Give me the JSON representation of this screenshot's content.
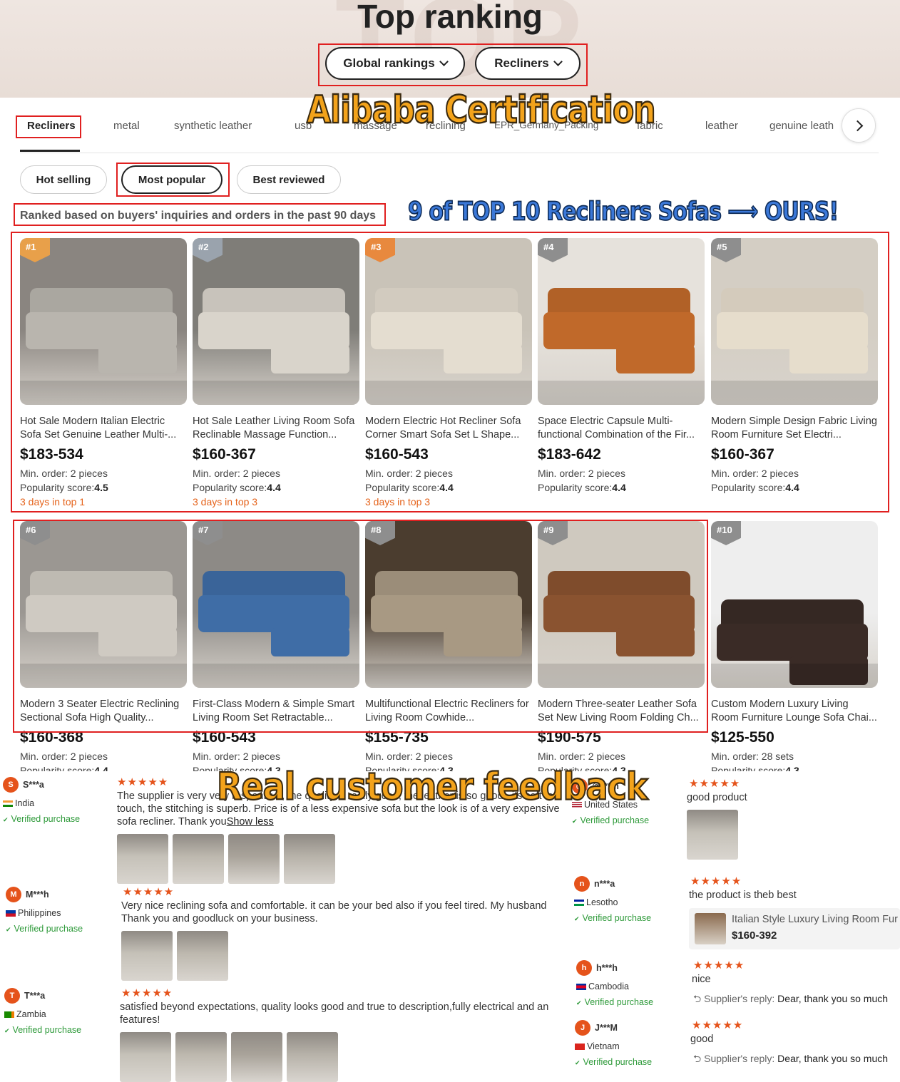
{
  "hero": {
    "title": "Top ranking",
    "dropdown_global": "Global rankings",
    "dropdown_category": "Recliners"
  },
  "overlays": {
    "certification": "Alibaba Certification",
    "top10": "9 of TOP 10 Recliners Sofas ⟶ OURS!",
    "feedback": "Real customer feedback"
  },
  "categories": [
    "Recliners",
    "metal",
    "synthetic leather",
    "usb",
    "massage",
    "reclining",
    "EPR_Germany_Packing",
    "fabric",
    "leather",
    "genuine leath"
  ],
  "filters": [
    "Hot selling",
    "Most popular",
    "Best reviewed"
  ],
  "ranked_note": "Ranked based on buyers' inquiries and orders in the past 90 days",
  "products": [
    {
      "rank": "#1",
      "title": "Hot Sale Modern Italian Electric Sofa Set Genuine Leather Multi-...",
      "price": "$183-534",
      "moq": "Min. order: 2 pieces",
      "pop_label": "Popularity score:",
      "pop_value": "4.5",
      "days": "3 days in top 1",
      "badge_color": "#e8a04a",
      "sofa_color": "#b9b5ae",
      "bg": "#8a8580"
    },
    {
      "rank": "#2",
      "title": "Hot Sale Leather Living Room Sofa Reclinable Massage Function...",
      "price": "$160-367",
      "moq": "Min. order: 2 pieces",
      "pop_label": "Popularity score:",
      "pop_value": "4.4",
      "days": "3 days in top 3",
      "badge_color": "#9aa3ad",
      "sofa_color": "#d9d4cb",
      "bg": "#7f7d78"
    },
    {
      "rank": "#3",
      "title": "Modern Electric Hot Recliner Sofa Corner Smart Sofa Set L Shape...",
      "price": "$160-543",
      "moq": "Min. order: 2 pieces",
      "pop_label": "Popularity score:",
      "pop_value": "4.4",
      "days": "3 days in top 3",
      "badge_color": "#e8893e",
      "sofa_color": "#e4ddd0",
      "bg": "#c9c3b8"
    },
    {
      "rank": "#4",
      "title": "Space Electric Capsule Multi-functional Combination of the Fir...",
      "price": "$183-642",
      "moq": "Min. order: 2 pieces",
      "pop_label": "Popularity score:",
      "pop_value": "4.4",
      "days": "",
      "badge_color": "#8e8e8e",
      "sofa_color": "#c0692a",
      "bg": "#e6e2dc"
    },
    {
      "rank": "#5",
      "title": "Modern Simple Design Fabric Living Room Furniture Set Electri...",
      "price": "$160-367",
      "moq": "Min. order: 2 pieces",
      "pop_label": "Popularity score:",
      "pop_value": "4.4",
      "days": "",
      "badge_color": "#8e8e8e",
      "sofa_color": "#e6ddcc",
      "bg": "#d4cec4"
    },
    {
      "rank": "#6",
      "title": "Modern 3 Seater Electric Reclining Sectional Sofa High Quality...",
      "price": "$160-368",
      "moq": "Min. order: 2 pieces",
      "pop_label": "Popularity score:",
      "pop_value": "4.4",
      "days": "",
      "badge_color": "#8e8e8e",
      "sofa_color": "#cfcac2",
      "bg": "#9b9792"
    },
    {
      "rank": "#7",
      "title": "First-Class Modern & Simple Smart Living Room Set Retractable...",
      "price": "$160-543",
      "moq": "Min. order: 2 pieces",
      "pop_label": "Popularity score:",
      "pop_value": "4.3",
      "days": "",
      "badge_color": "#8e8e8e",
      "sofa_color": "#3f6da6",
      "bg": "#8d8a86"
    },
    {
      "rank": "#8",
      "title": "Multifunctional Electric Recliners for Living Room Cowhide...",
      "price": "$155-735",
      "moq": "Min. order: 2 pieces",
      "pop_label": "Popularity score:",
      "pop_value": "4.3",
      "days": "",
      "badge_color": "#8e8e8e",
      "sofa_color": "#a89983",
      "bg": "#4b3d2f"
    },
    {
      "rank": "#9",
      "title": "Modern Three-seater Leather Sofa Set New Living Room Folding Ch...",
      "price": "$190-575",
      "moq": "Min. order: 2 pieces",
      "pop_label": "Popularity score:",
      "pop_value": "4.3",
      "days": "",
      "badge_color": "#8e8e8e",
      "sofa_color": "#8a5330",
      "bg": "#cfc9bf"
    },
    {
      "rank": "#10",
      "title": "Custom Modern Luxury Living Room Furniture Lounge Sofa Chai...",
      "price": "$125-550",
      "moq": "Min. order: 28 sets",
      "pop_label": "Popularity score:",
      "pop_value": "4.3",
      "days": "",
      "badge_color": "#8e8e8e",
      "sofa_color": "#3a2b26",
      "bg": "#eeeeee"
    }
  ],
  "reviews_left": [
    {
      "initial": "S",
      "name": "S***a",
      "country": "India",
      "verified": "Verified purchase",
      "stars": "★★★★★",
      "text": "The supplier is very very responsive, the quality is really good, the leather is so good , its soft to touch, the stitching is superb. Price is of a less expensive sofa but the look is of a very expensive sofa recliner. Thank you",
      "link": "Show less"
    },
    {
      "initial": "M",
      "name": "M***h",
      "country": "Philippines",
      "verified": "Verified purchase",
      "stars": "★★★★★",
      "text": "Very nice reclining sofa and comfortable. it can be your bed also if you feel tired. My husband Thank you and goodluck on your business."
    },
    {
      "initial": "T",
      "name": "T***a",
      "country": "Zambia",
      "verified": "Verified purchase",
      "stars": "★★★★★",
      "text": "satisfied beyond expectations, quality looks good and true to description,fully electrical and an features!"
    }
  ],
  "reviews_right": [
    {
      "initial": "@",
      "name": "@***m",
      "country": "United States",
      "verified": "Verified purchase",
      "stars": "★★★★★",
      "text": "good product"
    },
    {
      "initial": "n",
      "name": "n***a",
      "country": "Lesotho",
      "verified": "Verified purchase",
      "stars": "★★★★★",
      "text": "the product is theb best",
      "chip_title": "Italian Style Luxury Living Room Fur",
      "chip_price": "$160-392"
    },
    {
      "initial": "h",
      "name": "h***h",
      "country": "Cambodia",
      "verified": "Verified purchase",
      "stars": "★★★★★",
      "text": "nice",
      "reply_label": "Supplier's reply:",
      "reply_text": "Dear, thank you so much"
    },
    {
      "initial": "J",
      "name": "J***M",
      "country": "Vietnam",
      "verified": "Verified purchase",
      "stars": "★★★★★",
      "text": "good",
      "reply_label": "Supplier's reply:",
      "reply_text": "Dear, thank you so much"
    }
  ],
  "colors": {
    "accent_red": "#e02020",
    "star": "#e5531b",
    "verified": "#2e9a3a",
    "days": "#e5631b"
  }
}
